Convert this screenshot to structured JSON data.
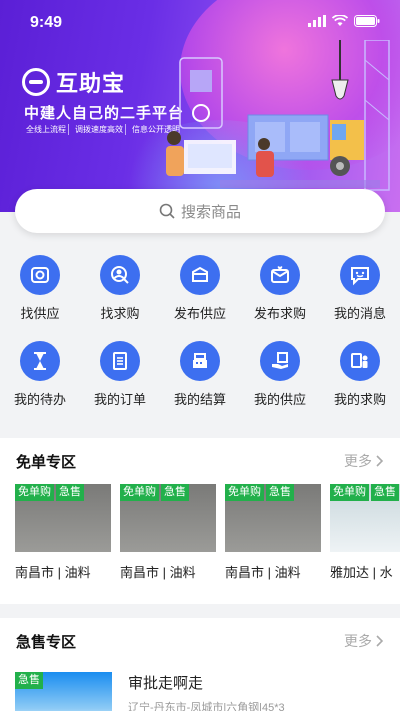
{
  "status": {
    "time": "9:49"
  },
  "hero": {
    "brand": "互助宝",
    "slogan": "中建人自己的二手平台",
    "features": [
      "全线上流程",
      "调拨速度高效",
      "信息公开透明"
    ]
  },
  "search": {
    "placeholder": "搜索商品"
  },
  "grid": [
    {
      "label": "找供应",
      "icon": "find-supply-icon"
    },
    {
      "label": "找求购",
      "icon": "find-demand-icon"
    },
    {
      "label": "发布供应",
      "icon": "publish-supply-icon"
    },
    {
      "label": "发布求购",
      "icon": "publish-demand-icon"
    },
    {
      "label": "我的消息",
      "icon": "message-icon"
    },
    {
      "label": "我的待办",
      "icon": "hourglass-icon"
    },
    {
      "label": "我的订单",
      "icon": "order-icon"
    },
    {
      "label": "我的结算",
      "icon": "cash-register-icon"
    },
    {
      "label": "我的供应",
      "icon": "my-supply-icon"
    },
    {
      "label": "我的求购",
      "icon": "my-demand-icon"
    }
  ],
  "free_section": {
    "title": "免单专区",
    "more": "更多",
    "items": [
      {
        "tags": [
          "免单购",
          "急售"
        ],
        "title": "南昌市 | 油料",
        "style": "dark"
      },
      {
        "tags": [
          "免单购",
          "急售"
        ],
        "title": "南昌市 | 油料",
        "style": "dark"
      },
      {
        "tags": [
          "免单购",
          "急售"
        ],
        "title": "南昌市 | 油料",
        "style": "dark"
      },
      {
        "tags": [
          "免单购",
          "急售"
        ],
        "title": "雅加达 | 水",
        "style": "pale"
      }
    ]
  },
  "urgent_section": {
    "title": "急售专区",
    "more": "更多",
    "items": [
      {
        "tag": "急售",
        "title": "审批走啊走",
        "subtitle": "辽宁-丹东市-凤城市|六角钢|45*3"
      }
    ]
  }
}
